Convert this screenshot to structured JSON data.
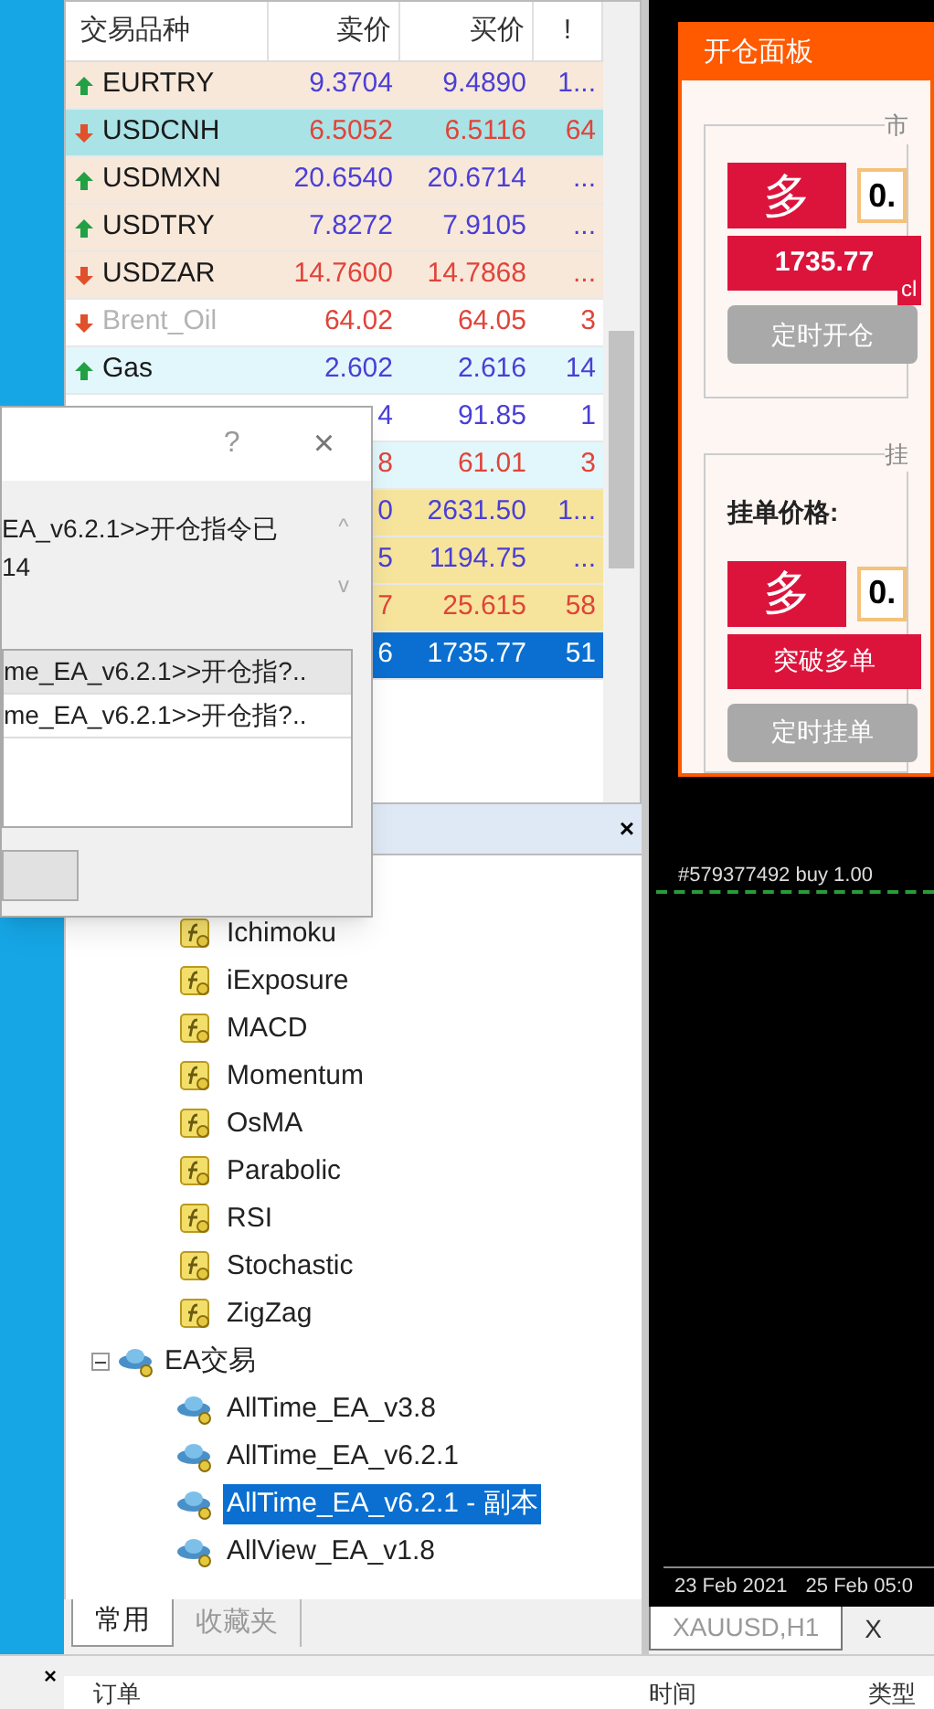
{
  "market_watch": {
    "columns": [
      "交易品种",
      "卖价",
      "买价",
      "!"
    ],
    "rows": [
      {
        "symbol": "EURTRY",
        "bid": "9.3704",
        "ask": "9.4890",
        "spread": "1...",
        "kind": "up",
        "color": "#f8e8da",
        "selected": false,
        "inactive": false
      },
      {
        "symbol": "USDCNH",
        "bid": "6.5052",
        "ask": "6.5116",
        "spread": "64",
        "kind": "down",
        "color": "#a9e3e6",
        "selected": false,
        "inactive": false
      },
      {
        "symbol": "USDMXN",
        "bid": "20.6540",
        "ask": "20.6714",
        "spread": "...",
        "kind": "up",
        "color": "#f8e8da",
        "selected": false,
        "inactive": false
      },
      {
        "symbol": "USDTRY",
        "bid": "7.8272",
        "ask": "7.9105",
        "spread": "...",
        "kind": "up",
        "color": "#f8e8da",
        "selected": false,
        "inactive": false
      },
      {
        "symbol": "USDZAR",
        "bid": "14.7600",
        "ask": "14.7868",
        "spread": "...",
        "kind": "down",
        "color": "#f8e8da",
        "selected": false,
        "inactive": false
      },
      {
        "symbol": "Brent_Oil",
        "bid": "64.02",
        "ask": "64.05",
        "spread": "3",
        "kind": "down",
        "color": "#ffffff",
        "selected": false,
        "inactive": true
      },
      {
        "symbol": "Gas",
        "bid": "2.602",
        "ask": "2.616",
        "spread": "14",
        "kind": "up",
        "color": "#e2f7fb",
        "selected": false,
        "inactive": false
      },
      {
        "bid": "4",
        "ask": "91.85",
        "spread": "1",
        "kind": "up",
        "color": "#ffffff",
        "selected": false
      },
      {
        "bid": "8",
        "ask": "61.01",
        "spread": "3",
        "kind": "down",
        "color": "#e2f7fb",
        "selected": false
      },
      {
        "bid": "0",
        "ask": "2631.50",
        "spread": "1...",
        "kind": "up",
        "color": "#f6e49c",
        "selected": false
      },
      {
        "bid": "5",
        "ask": "1194.75",
        "spread": "...",
        "kind": "up",
        "color": "#f6e49c",
        "selected": false
      },
      {
        "bid": "7",
        "ask": "25.615",
        "spread": "58",
        "kind": "down",
        "color": "#f6e49c",
        "selected": false
      },
      {
        "bid": "6",
        "ask": "1735.77",
        "spread": "51",
        "color": "#0a6fd0",
        "selected": true
      }
    ]
  },
  "dialog": {
    "title_buttons": [
      "?",
      "×"
    ],
    "message": [
      "EA_v6.2.1>>开仓指令已",
      "14"
    ],
    "scroll_arrows": [
      "^",
      "v"
    ],
    "list": [
      {
        "text": "me_EA_v6.2.1>>开仓指?..",
        "selected": true
      },
      {
        "text": "me_EA_v6.2.1>>开仓指?..",
        "selected": false
      }
    ]
  },
  "navigator": {
    "close": "×",
    "items": [
      {
        "label": "Ichimoku",
        "kind": "indicator"
      },
      {
        "label": "iExposure",
        "kind": "indicator"
      },
      {
        "label": "MACD",
        "kind": "indicator"
      },
      {
        "label": "Momentum",
        "kind": "indicator"
      },
      {
        "label": "OsMA",
        "kind": "indicator"
      },
      {
        "label": "Parabolic",
        "kind": "indicator"
      },
      {
        "label": "RSI",
        "kind": "indicator"
      },
      {
        "label": "Stochastic",
        "kind": "indicator"
      },
      {
        "label": "ZigZag",
        "kind": "indicator"
      },
      {
        "label": "EA交易",
        "kind": "folder",
        "expanded": true,
        "children": [
          {
            "label": "AllTime_EA_v3.8",
            "kind": "expert",
            "selected": false
          },
          {
            "label": "AllTime_EA_v6.2.1",
            "kind": "expert",
            "selected": false
          },
          {
            "label": "AllTime_EA_v6.2.1 - 副本",
            "kind": "expert",
            "selected": true
          },
          {
            "label": "AllView_EA_v1.8",
            "kind": "expert",
            "selected": false
          }
        ]
      }
    ],
    "tabs": [
      {
        "label": "常用",
        "selected": true
      },
      {
        "label": "收藏夹",
        "selected": false
      }
    ]
  },
  "order_panel": {
    "title": "开仓面板",
    "market_group": {
      "legend": "市",
      "buy": "多",
      "lot": "0.",
      "price": "1735.77",
      "badge": "cl",
      "timed": "定时开仓"
    },
    "pending_group": {
      "legend": "挂",
      "price_label": "挂单价格:",
      "buy": "多",
      "lot": "0.",
      "breakout": "突破多单",
      "timed": "定时挂单"
    }
  },
  "chart": {
    "order_line": "#579377492 buy 1.00",
    "dates": [
      "23 Feb 2021",
      "25 Feb 05:0"
    ],
    "tabs": [
      {
        "label": "XAUUSD,H1",
        "selected": true
      },
      {
        "label": "X",
        "selected": false
      }
    ]
  },
  "toolbox": {
    "close": "×",
    "columns": [
      "订单",
      "时间",
      "类型"
    ]
  }
}
